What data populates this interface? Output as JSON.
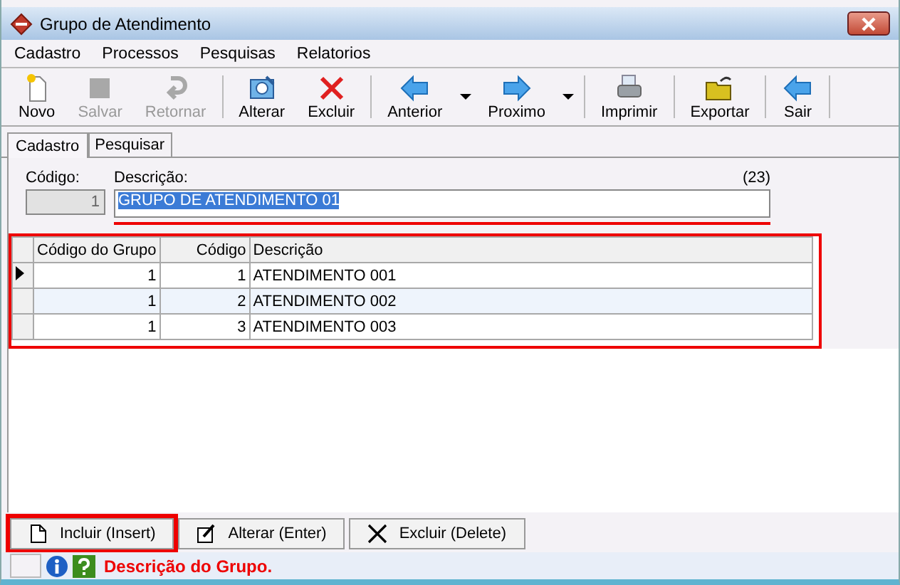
{
  "window": {
    "title": "Grupo de Atendimento"
  },
  "menu": [
    "Cadastro",
    "Processos",
    "Pesquisas",
    "Relatorios"
  ],
  "toolbar": [
    {
      "kind": "new",
      "label": "Novo",
      "disabled": false
    },
    {
      "kind": "save",
      "label": "Salvar",
      "disabled": true
    },
    {
      "kind": "undo",
      "label": "Retornar",
      "disabled": true
    },
    {
      "kind": "separator"
    },
    {
      "kind": "edit",
      "label": "Alterar",
      "disabled": false
    },
    {
      "kind": "delete",
      "label": "Excluir",
      "disabled": false
    },
    {
      "kind": "separator"
    },
    {
      "kind": "prev",
      "label": "Anterior",
      "disabled": false
    },
    {
      "kind": "dropdown"
    },
    {
      "kind": "next",
      "label": "Proximo",
      "disabled": false
    },
    {
      "kind": "dropdown"
    },
    {
      "kind": "separator"
    },
    {
      "kind": "print",
      "label": "Imprimir",
      "disabled": false
    },
    {
      "kind": "separator"
    },
    {
      "kind": "export",
      "label": "Exportar",
      "disabled": false
    },
    {
      "kind": "separator"
    },
    {
      "kind": "exit",
      "label": "Sair",
      "disabled": false
    },
    {
      "kind": "separator"
    }
  ],
  "tabs": [
    {
      "label": "Cadastro",
      "selected": true
    },
    {
      "label": "Pesquisar",
      "selected": false
    }
  ],
  "form": {
    "code_label": "Código:",
    "code_value": "1",
    "desc_label": "Descrição:",
    "desc_count": "(23)",
    "desc_value": "GRUPO DE ATENDIMENTO 01",
    "desc_highlighted": true
  },
  "table": {
    "highlighted": true,
    "columns": [
      "Código do Grupo",
      "Código",
      "Descrição"
    ],
    "rows": [
      {
        "cells": [
          "1",
          "1",
          "ATENDIMENTO 001"
        ],
        "selected": true
      },
      {
        "cells": [
          "1",
          "2",
          "ATENDIMENTO 002"
        ],
        "selected": false
      },
      {
        "cells": [
          "1",
          "3",
          "ATENDIMENTO 003"
        ],
        "selected": false
      }
    ]
  },
  "actions": [
    {
      "kind": "insert",
      "label": "Incluir (Insert)",
      "highlighted": true
    },
    {
      "kind": "edit",
      "label": "Alterar (Enter)",
      "highlighted": false
    },
    {
      "kind": "delete",
      "label": "Excluir (Delete)",
      "highlighted": false
    }
  ],
  "status_bar": {
    "message": "Descrição do Grupo."
  }
}
